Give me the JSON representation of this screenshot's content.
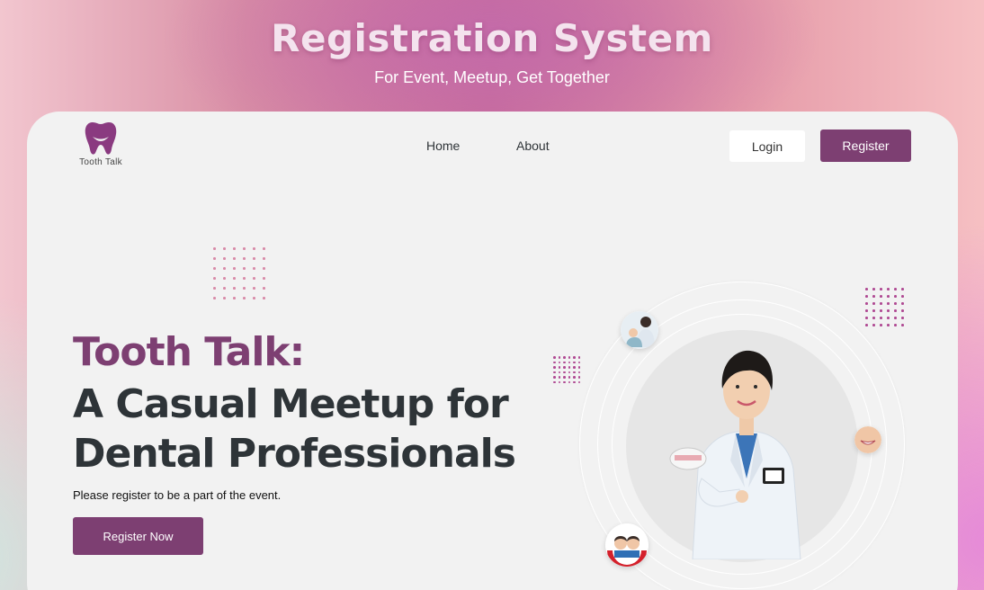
{
  "banner": {
    "title": "Registration System",
    "subtitle": "For Event, Meetup, Get Together"
  },
  "nav": {
    "logo_text": "Tooth Talk",
    "links": [
      "Home",
      "About"
    ],
    "login_label": "Login",
    "register_label": "Register"
  },
  "hero": {
    "title_line1": "Tooth Talk:",
    "title_line2": "A Casual Meetup for Dental Professionals",
    "subtitle": "Please register to be a part of the event.",
    "cta_label": "Register Now"
  },
  "colors": {
    "brand": "#7d3f72",
    "heading": "#2e3438",
    "card_bg": "#f2f2f2",
    "dot_pink": "#d88aa8",
    "dot_purple": "#b04a93"
  },
  "icons": [
    "tooth-logo-icon",
    "dentist-photo",
    "patient-smile-photo",
    "kids-photo",
    "dentist-with-patient-photo"
  ]
}
